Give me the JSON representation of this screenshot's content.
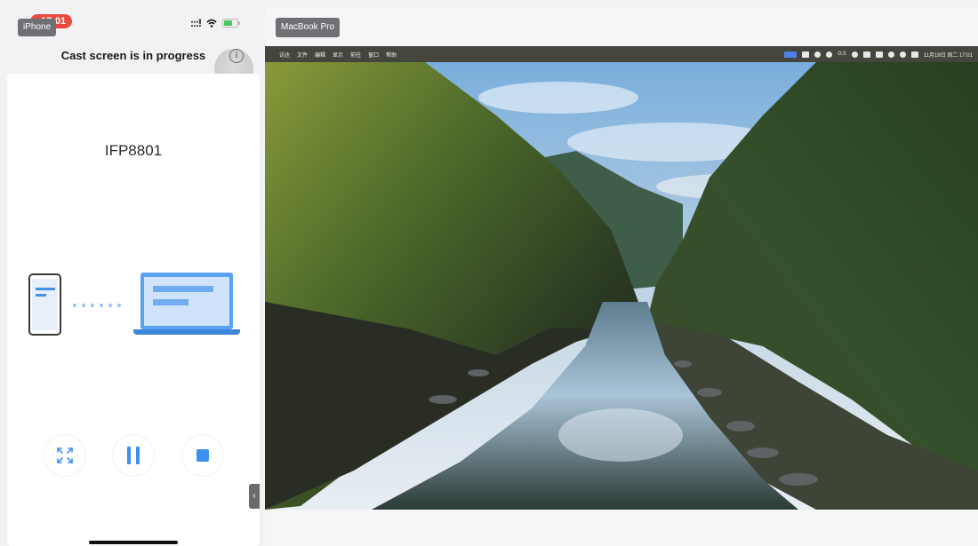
{
  "phone": {
    "device_tag": "iPhone",
    "status_time": "17:01",
    "signal_glyph": ":::!",
    "cast_title": "Cast screen is in progress",
    "info_glyph": "i",
    "device_name": "IFP8801",
    "controls": [
      {
        "name": "fullscreen-expand-icon"
      },
      {
        "name": "pause-icon"
      },
      {
        "name": "stop-icon"
      }
    ],
    "collapse_glyph": "‹",
    "accent_color": "#3d8ff0"
  },
  "mac": {
    "device_tag": "MacBook Pro",
    "menubar": {
      "apple_glyph": "",
      "items": [
        "访达",
        "文件",
        "编辑",
        "显示",
        "前往",
        "窗口",
        "帮助"
      ],
      "battery_text": "Ⲟ.5",
      "clock": "11月19日 周二 17:01"
    }
  }
}
